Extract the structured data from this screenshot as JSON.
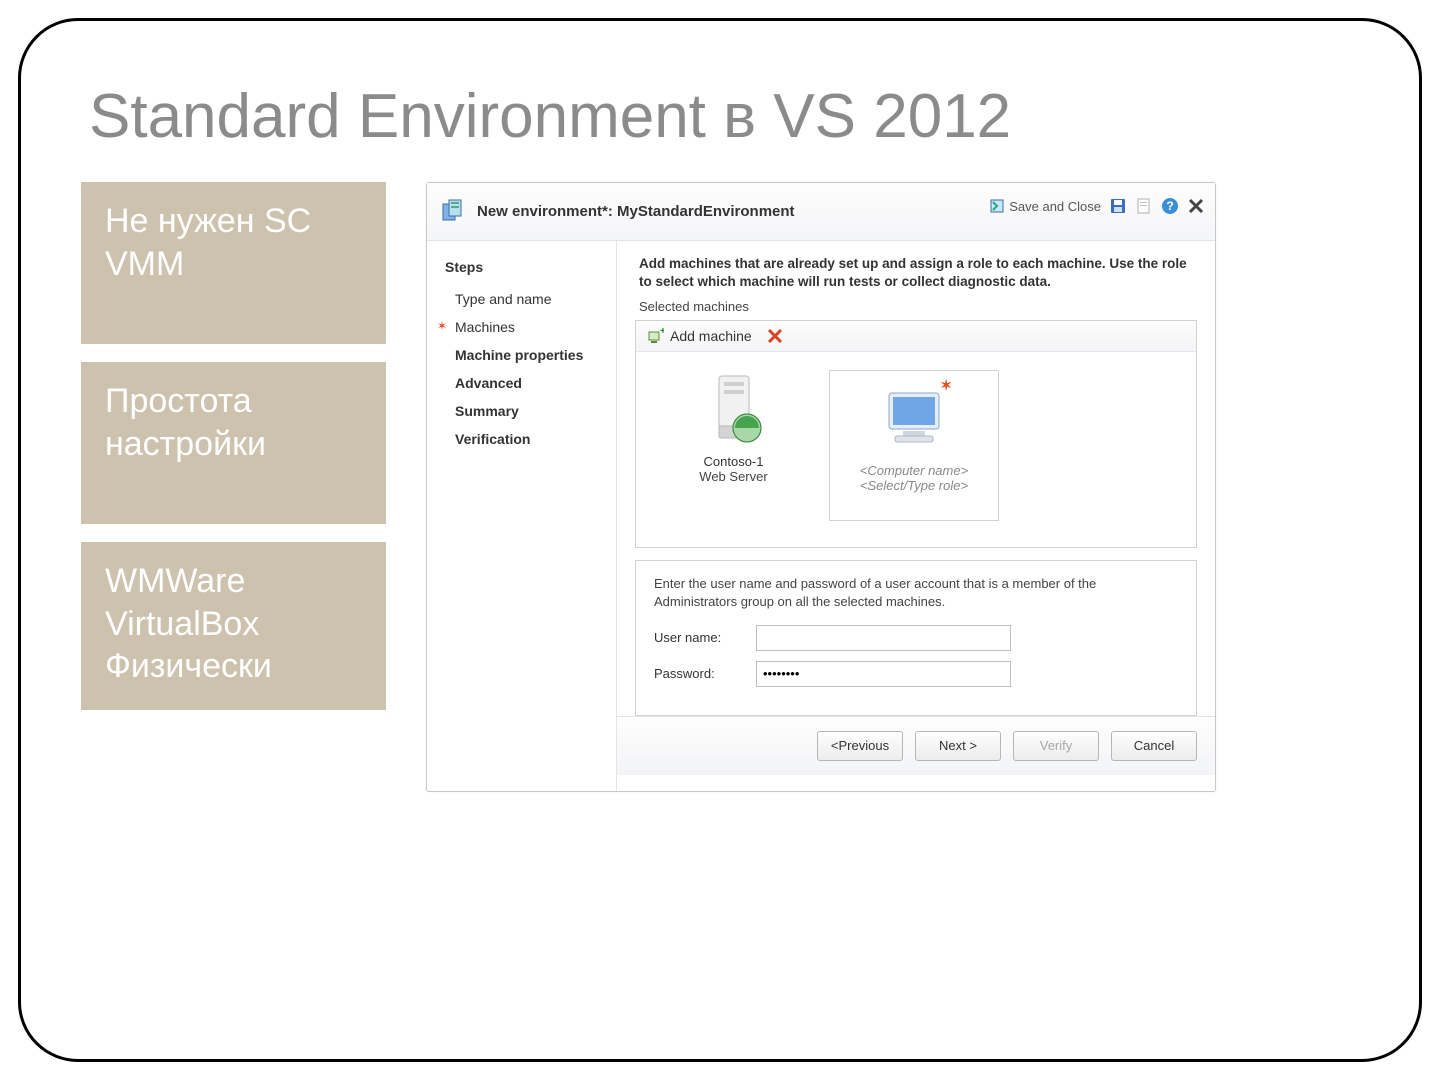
{
  "slide": {
    "title": "Standard Environment в VS 2012"
  },
  "cards": [
    "Не нужен SC VMM",
    "Простота настройки",
    "WMWare\nVirtualBox\nФизически"
  ],
  "dialog": {
    "title": "New environment*: MyStandardEnvironment",
    "save_close": "Save and Close",
    "steps_heading": "Steps",
    "steps": {
      "type_name": "Type and name",
      "machines": "Machines",
      "machine_props": "Machine properties",
      "advanced": "Advanced",
      "summary": "Summary",
      "verification": "Verification"
    },
    "instructions": "Add machines that are already set up and assign a role to each machine. Use the role to select which machine will run tests or collect diagnostic data.",
    "selected_label": "Selected machines",
    "add_machine": "Add machine",
    "tiles": {
      "contoso": {
        "name": "Contoso-1",
        "role": "Web Server"
      },
      "placeholder": {
        "name": "<Computer name>",
        "role": "<Select/Type role>"
      }
    },
    "credentials": {
      "desc": "Enter the user name and password of a user account that is a member of the Administrators group on all the selected machines.",
      "user_label": "User name:",
      "pass_label": "Password:",
      "user_value": "",
      "pass_value": "••••••••"
    },
    "buttons": {
      "prev": "<Previous",
      "next": "Next >",
      "verify": "Verify",
      "cancel": "Cancel"
    }
  }
}
